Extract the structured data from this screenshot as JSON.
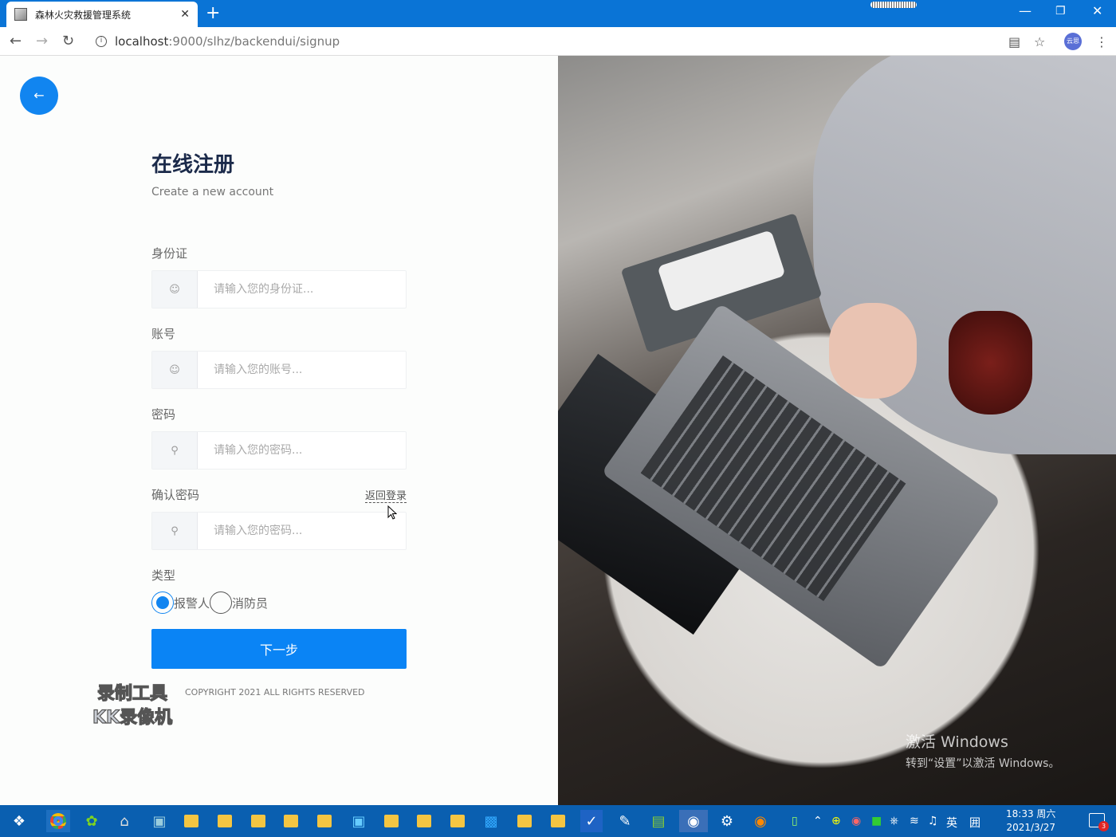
{
  "browser": {
    "tab_title": "森林火灾救援管理系统",
    "url_host": "localhost",
    "url_path": ":9000/slhz/backendui/signup",
    "new_tab_symbol": "+",
    "close_tab_symbol": "✕",
    "profile_label": "云思"
  },
  "form": {
    "title": "在线注册",
    "subtitle": "Create a new account",
    "id_label": "身份证",
    "id_placeholder": "请输入您的身份证...",
    "account_label": "账号",
    "account_placeholder": "请输入您的账号...",
    "password_label": "密码",
    "password_placeholder": "请输入您的密码...",
    "confirm_label": "确认密码",
    "confirm_placeholder": "请输入您的密码...",
    "back_to_login": "返回登录",
    "type_label": "类型",
    "type_options": [
      "报警人",
      "消防员"
    ],
    "type_selected": "报警人",
    "submit_label": "下一步",
    "copyright": "COPYRIGHT 2021 ALL RIGHTS RESERVED"
  },
  "watermark": {
    "line1": "录制工具",
    "line2": "KK录像机"
  },
  "activation": {
    "line1": "激活 Windows",
    "line2": "转到“设置”以激活 Windows。"
  },
  "taskbar": {
    "ime": "英",
    "ime_mode": "囲",
    "time": "18:33 周六",
    "date": "2021/3/27",
    "notification_count": "3"
  },
  "colors": {
    "accent": "#0a84f5",
    "title_bar": "#0a74d6",
    "taskbar": "#0a5fb0"
  }
}
